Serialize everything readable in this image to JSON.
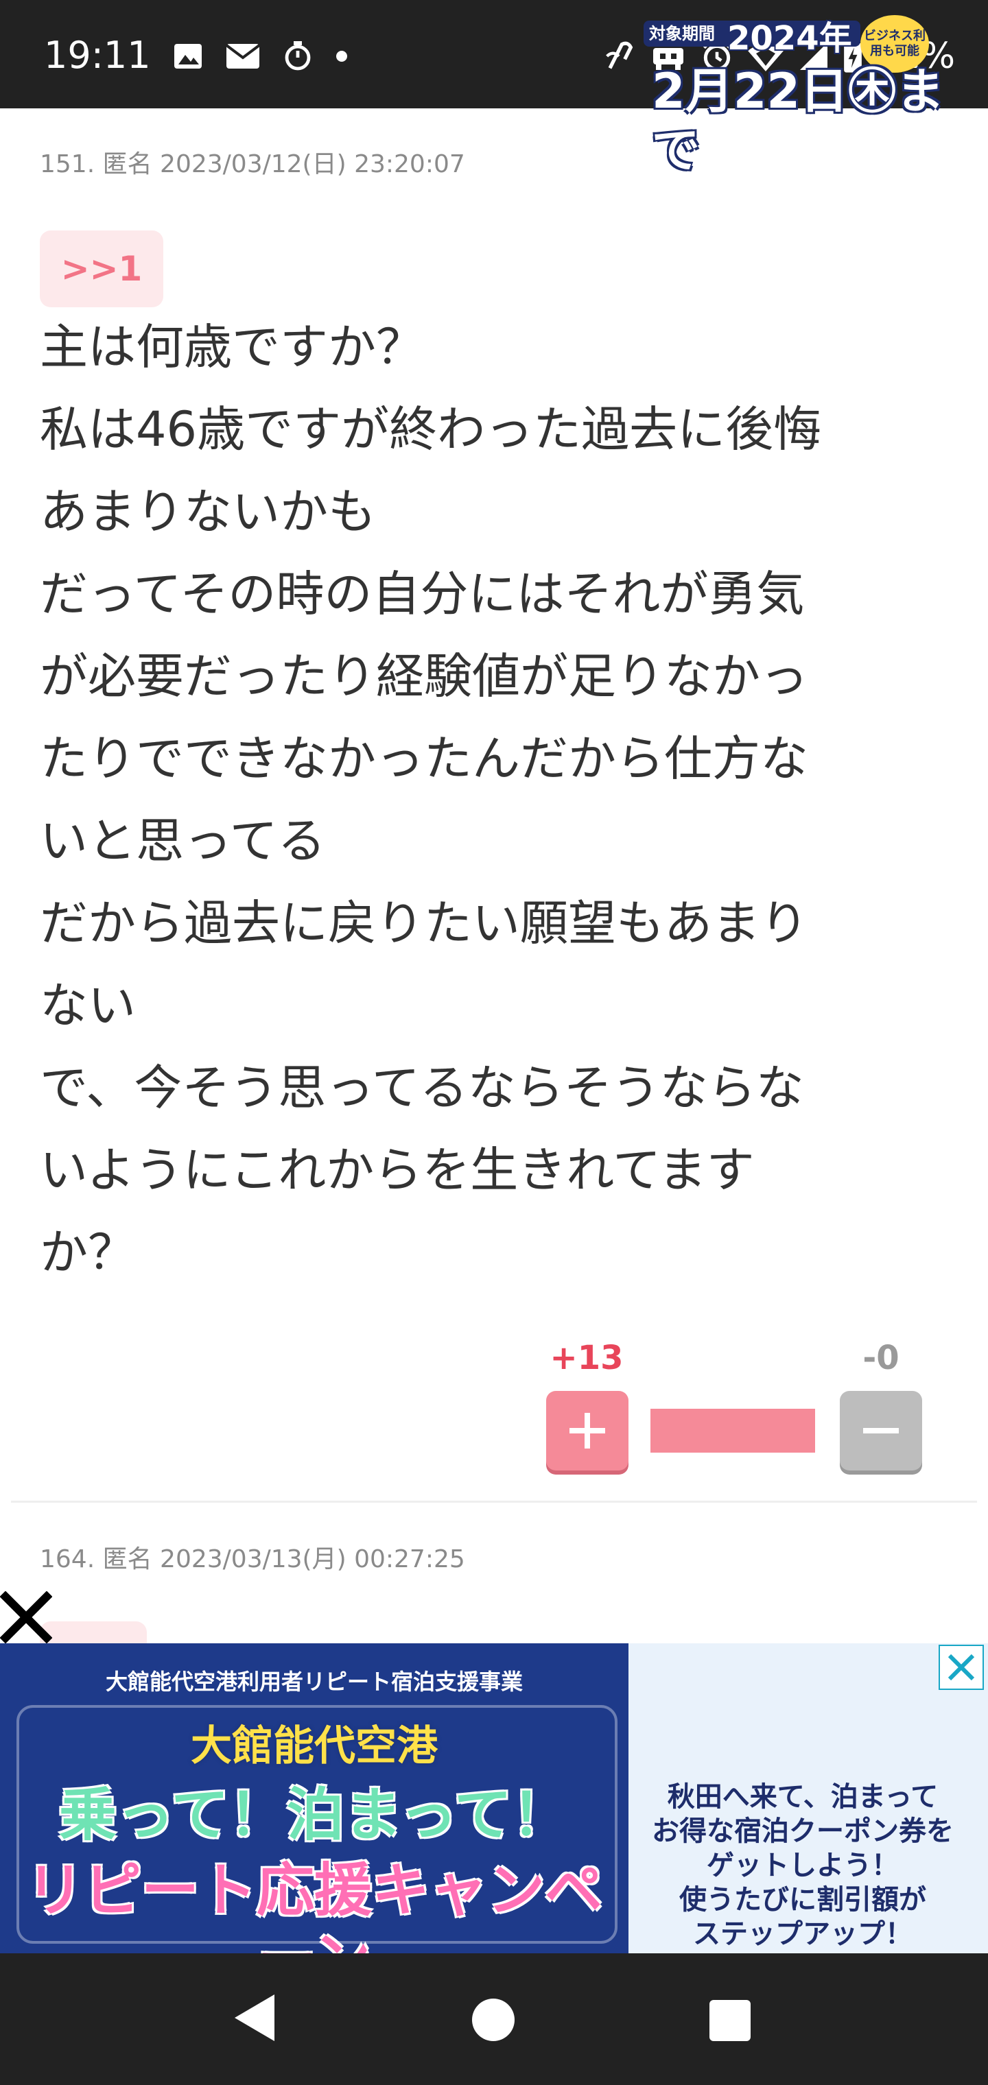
{
  "status_bar": {
    "time": "19:11",
    "left_icons": [
      "image-icon",
      "au-mail-icon",
      "stopwatch-icon",
      "dot-icon"
    ],
    "right_icons": [
      "nfc-icon",
      "vibrate-icon",
      "alarm-icon",
      "wifi-icon",
      "signal-icon",
      "battery-charging-icon"
    ],
    "battery_percent": "72%"
  },
  "post": {
    "meta": "151. 匿名 2023/03/12(日) 23:20:07",
    "anchor": ">>1",
    "body_lines": [
      "主は何歳ですか？",
      "私は46歳ですが終わった過去に後悔",
      "あまりないかも",
      "だってその時の自分にはそれが勇気",
      "が必要だったり経験値が足りなかっ",
      "たりでできなかったんだから仕方な",
      "いと思ってる",
      "だから過去に戻りたい願望もあまり",
      "ない",
      "で、今そう思ってるならそうならな",
      "いようにこれからを生きれてます",
      "か？"
    ],
    "vote": {
      "plus_count": "+13",
      "minus_count": "-0",
      "plus_symbol": "+",
      "minus_symbol": "−",
      "plus_ratio": 1.0,
      "plus_color": "#f58a98",
      "minus_color": "#bdbdbd"
    }
  },
  "next_post": {
    "meta": "164. 匿名 2023/03/13(月) 00:27:25"
  },
  "ad": {
    "topline": "大館能代空港利用者リピート宿泊支援事業",
    "airport": "大館能代空港",
    "catch": "乗って！泊まって！",
    "campaign": "リピート応援キャンペーン",
    "period_label": "対象期間",
    "year": "2024年",
    "biz_badge": "ビジネス利用も可能",
    "date": "2月22日㊍まで",
    "right_lines": [
      "秋田へ来て、泊まって",
      "お得な宿泊クーポン券を",
      "ゲットしよう！",
      "使うたびに割引額が",
      "ステップアップ！"
    ],
    "left_color": "#1e3a8a",
    "right_color": "#e9f2fb"
  },
  "nav_bar": {
    "buttons": [
      "back-icon",
      "home-icon",
      "recents-icon"
    ]
  }
}
